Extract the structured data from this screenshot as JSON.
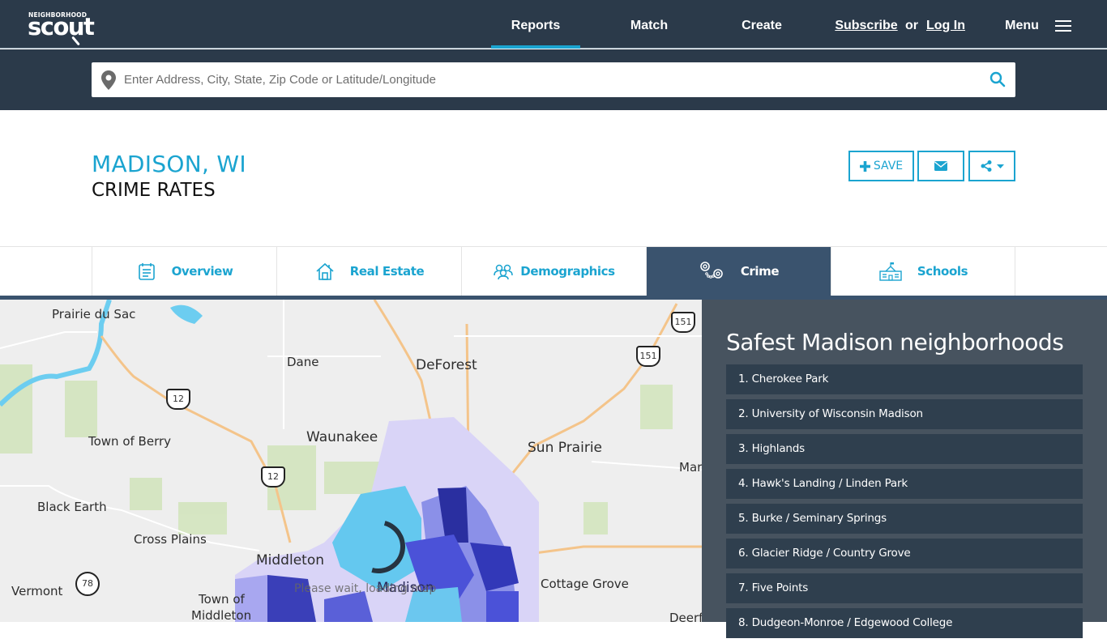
{
  "brand": {
    "top": "NEIGHBORHOOD",
    "name": "scout"
  },
  "nav": {
    "items": [
      {
        "label": "Reports",
        "active": true
      },
      {
        "label": "Match",
        "active": false
      },
      {
        "label": "Create",
        "active": false
      }
    ],
    "subscribe": "Subscribe",
    "or": "or",
    "login": "Log In",
    "menu": "Menu"
  },
  "search": {
    "placeholder": "Enter Address, City, State, Zip Code or Latitude/Longitude",
    "value": ""
  },
  "header": {
    "city": "MADISON, WI",
    "subtitle": "CRIME RATES",
    "save_label": "SAVE"
  },
  "tabs": [
    {
      "label": "Overview",
      "icon": "calendar-icon",
      "active": false
    },
    {
      "label": "Real Estate",
      "icon": "house-icon",
      "active": false
    },
    {
      "label": "Demographics",
      "icon": "people-icon",
      "active": false
    },
    {
      "label": "Crime",
      "icon": "handcuffs-icon",
      "active": true
    },
    {
      "label": "Schools",
      "icon": "school-icon",
      "active": false
    }
  ],
  "map": {
    "labels": [
      "Prairie du Sac",
      "Dane",
      "DeForest",
      "Town of Berry",
      "Waunakee",
      "Sun Prairie",
      "Marshall",
      "Black Earth",
      "Cross Plains",
      "Middleton",
      "Cottage Grove",
      "Vermont",
      "Town of",
      "Middleton",
      "Madison",
      "Deerfield"
    ],
    "routes": [
      "12",
      "12",
      "151",
      "151",
      "78"
    ],
    "loading_text": "Please wait, loading map"
  },
  "panel": {
    "title": "Safest Madison neighborhoods",
    "items": [
      "1. Cherokee Park",
      "2. University of Wisconsin Madison",
      "3. Highlands",
      "4. Hawk's Landing / Linden Park",
      "5. Burke / Seminary Springs",
      "6. Glacier Ridge / Country Grove",
      "7. Five Points",
      "8. Dudgeon-Monroe / Edgewood College"
    ]
  },
  "colors": {
    "accent": "#1ba4d0",
    "navbg": "#2b3a4a",
    "activeTab": "#3a536e",
    "panel": "#47535f",
    "panelItem": "#2f3f4e"
  }
}
